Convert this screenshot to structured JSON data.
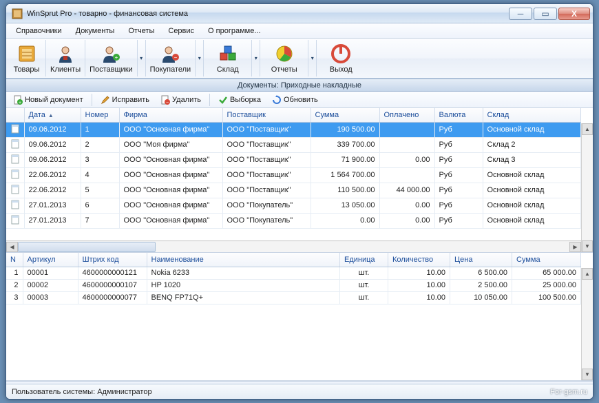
{
  "window": {
    "title": "WinSprut Pro - товарно - финансовая система"
  },
  "menu": {
    "items": [
      "Справочники",
      "Документы",
      "Отчеты",
      "Сервис",
      "О программе..."
    ]
  },
  "toolbar": {
    "items": [
      {
        "label": "Товары",
        "icon": "goods"
      },
      {
        "label": "Клиенты",
        "icon": "clients"
      },
      {
        "label": "Поставщики",
        "icon": "suppliers",
        "dropdown": true
      },
      {
        "label": "Покупатели",
        "icon": "buyers",
        "dropdown": true
      },
      {
        "label": "Склад",
        "icon": "warehouse",
        "dropdown": true
      },
      {
        "label": "Отчеты",
        "icon": "reports",
        "dropdown": true
      },
      {
        "label": "Выход",
        "icon": "exit"
      }
    ]
  },
  "section_title": "Документы: Приходные накладные",
  "actions": {
    "new": "Новый документ",
    "edit": "Исправить",
    "delete": "Удалить",
    "filter": "Выборка",
    "refresh": "Обновить"
  },
  "docs": {
    "columns": [
      "Дата",
      "Номер",
      "Фирма",
      "Поставщик",
      "Сумма",
      "Оплачено",
      "Валюта",
      "Склад"
    ],
    "rows": [
      {
        "date": "09.06.2012",
        "num": "1",
        "firm": "ООО \"Основная фирма\"",
        "supplier": "ООО \"Поставщик\"",
        "sum": "190 500.00",
        "paid": "",
        "currency": "Руб",
        "warehouse": "Основной склад",
        "selected": true
      },
      {
        "date": "09.06.2012",
        "num": "2",
        "firm": "ООО \"Моя фирма\"",
        "supplier": "ООО \"Поставщик\"",
        "sum": "339 700.00",
        "paid": "",
        "currency": "Руб",
        "warehouse": "Склад 2"
      },
      {
        "date": "09.06.2012",
        "num": "3",
        "firm": "ООО \"Основная фирма\"",
        "supplier": "ООО \"Поставщик\"",
        "sum": "71 900.00",
        "paid": "0.00",
        "currency": "Руб",
        "warehouse": "Склад 3"
      },
      {
        "date": "22.06.2012",
        "num": "4",
        "firm": "ООО \"Основная фирма\"",
        "supplier": "ООО \"Поставщик\"",
        "sum": "1 564 700.00",
        "paid": "",
        "currency": "Руб",
        "warehouse": "Основной склад"
      },
      {
        "date": "22.06.2012",
        "num": "5",
        "firm": "ООО \"Основная фирма\"",
        "supplier": "ООО \"Поставщик\"",
        "sum": "110 500.00",
        "paid": "44 000.00",
        "currency": "Руб",
        "warehouse": "Основной склад"
      },
      {
        "date": "27.01.2013",
        "num": "6",
        "firm": "ООО \"Основная фирма\"",
        "supplier": "ООО \"Покупатель\"",
        "sum": "13 050.00",
        "paid": "0.00",
        "currency": "Руб",
        "warehouse": "Основной склад"
      },
      {
        "date": "27.01.2013",
        "num": "7",
        "firm": "ООО \"Основная фирма\"",
        "supplier": "ООО \"Покупатель\"",
        "sum": "0.00",
        "paid": "0.00",
        "currency": "Руб",
        "warehouse": "Основной склад"
      }
    ]
  },
  "items": {
    "columns": [
      "N",
      "Артикул",
      "Штрих код",
      "Наименование",
      "Единица",
      "Количество",
      "Цена",
      "Сумма"
    ],
    "rows": [
      {
        "n": "1",
        "art": "00001",
        "barcode": "4600000000121",
        "name": "Nokia 6233",
        "unit": "шт.",
        "qty": "10.00",
        "price": "6 500.00",
        "sum": "65 000.00"
      },
      {
        "n": "2",
        "art": "00002",
        "barcode": "4600000000107",
        "name": "HP 1020",
        "unit": "шт.",
        "qty": "10.00",
        "price": "2 500.00",
        "sum": "25 000.00"
      },
      {
        "n": "3",
        "art": "00003",
        "barcode": "4600000000077",
        "name": "BENQ FP71Q+",
        "unit": "шт.",
        "qty": "10.00",
        "price": "10 050.00",
        "sum": "100 500.00"
      }
    ]
  },
  "status": {
    "user_label": "Пользователь системы:",
    "user_value": "Администратор",
    "watermark": "For-gsm.ru"
  }
}
